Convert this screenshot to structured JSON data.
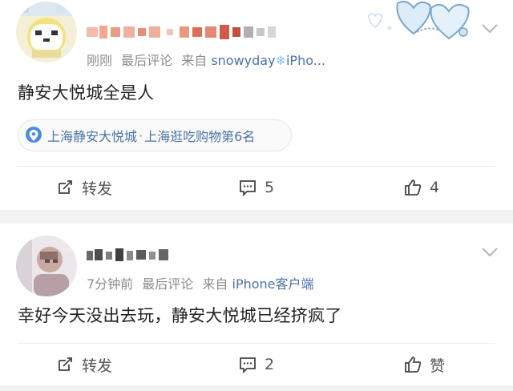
{
  "posts": [
    {
      "username": "[blurred]",
      "time": "刚刚",
      "meta_label": "最后评论",
      "from_label": "来自",
      "source": "snowyday",
      "source_suffix": "iPho...",
      "content": "静安大悦城全是人",
      "location": {
        "name": "上海静安大悦城",
        "separator": "·",
        "rank": "上海逛吃购物第6名"
      },
      "actions": {
        "repost": "转发",
        "comments": "5",
        "likes": "4"
      }
    },
    {
      "username": "[blurred]",
      "time": "7分钟前",
      "meta_label": "最后评论",
      "from_label": "来自",
      "source": "iPhone客户端",
      "content": "幸好今天没出去玩，静安大悦城已经挤疯了",
      "actions": {
        "repost": "转发",
        "comments": "2",
        "likes": "赞"
      }
    }
  ],
  "colors": {
    "link": "#4a72a8",
    "meta": "#8c8c8c",
    "text": "#222222",
    "separator": "#f2f2f2"
  }
}
